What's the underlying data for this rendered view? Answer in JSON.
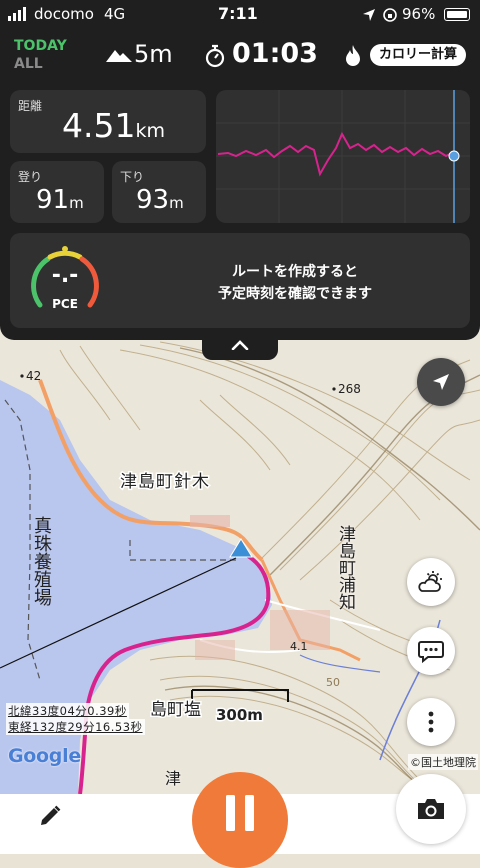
{
  "status_bar": {
    "carrier": "docomo",
    "network": "4G",
    "time": "7:11",
    "battery": "96%"
  },
  "header": {
    "mode_today": "TODAY",
    "mode_all": "ALL",
    "elevation": "5m",
    "elapsed": "01:03",
    "calorie_button": "カロリー計算"
  },
  "stats": {
    "distance_label": "距離",
    "distance_value": "4.51",
    "distance_unit": "km",
    "ascent_label": "登り",
    "ascent_value": "91",
    "ascent_unit": "m",
    "descent_label": "下り",
    "descent_value": "93",
    "descent_unit": "m"
  },
  "pace": {
    "gauge_value": "-.-",
    "gauge_label": "PCE",
    "message_line1": "ルートを作成すると",
    "message_line2": "予定時刻を確認できます"
  },
  "map": {
    "labels": {
      "spot_height_42": "42",
      "spot_height_268": "268",
      "town_harikoi": "津島町針木",
      "pearl_farm": "真珠養殖場",
      "town_uranouchi": "津島町浦知",
      "town_shio": "島町塩",
      "town_bottom": "津島",
      "point_41": "4.1",
      "contour_50": "50"
    },
    "scale_label": "300m",
    "coord_lat": "北緯33度04分0.39秒",
    "coord_lon": "東経132度29分16.53秒",
    "google_logo": "Google",
    "attribution": "©国土地理院"
  },
  "colors": {
    "panel_bg": "#1f1f1f",
    "card_bg": "#303030",
    "accent_green": "#4cc36a",
    "track_magenta": "#d8238f",
    "record_orange": "#f07a3a",
    "position_blue": "#3b8fd6"
  },
  "icons": {
    "elevation": "mountain-icon",
    "timer": "stopwatch-icon",
    "calorie": "flame-icon",
    "collapse": "chevron-up-icon",
    "locate": "navigation-arrow-icon",
    "weather": "weather-icon",
    "chat": "chat-bubble-icon",
    "more": "more-vertical-icon",
    "edit": "pencil-icon",
    "record": "pause-icon",
    "camera": "camera-icon"
  }
}
